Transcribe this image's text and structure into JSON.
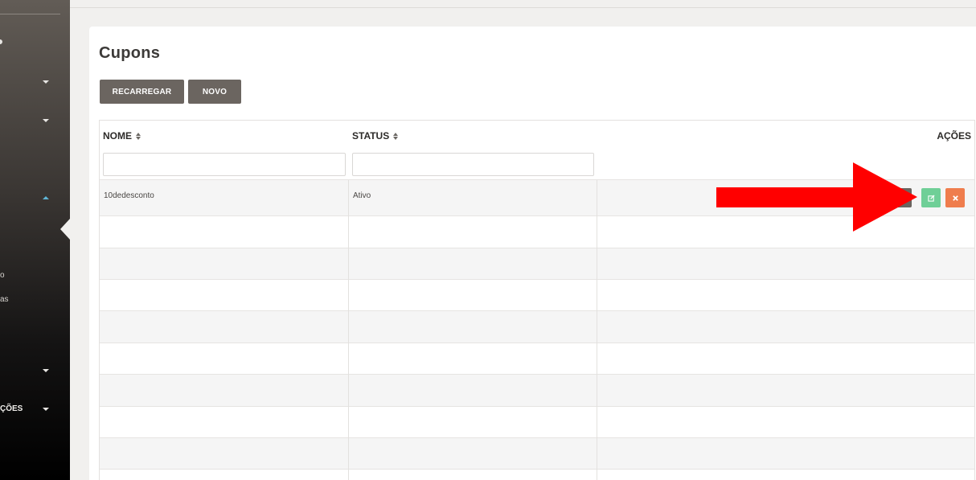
{
  "sidebar": {
    "items": [
      {
        "label": "o"
      },
      {
        "label": "as"
      },
      {
        "label": "ÇÕES"
      }
    ]
  },
  "page": {
    "title": "Cupons",
    "buttons": {
      "reload": "RECARREGAR",
      "new": "NOVO"
    }
  },
  "table": {
    "columns": [
      "NOME",
      "STATUS",
      "AÇÕES"
    ],
    "filters": {
      "nome": "",
      "status": ""
    },
    "rows": [
      {
        "nome": "10dedesconto",
        "status": "Ativo"
      }
    ]
  },
  "annotation": {
    "arrow_color": "#ff0000"
  }
}
